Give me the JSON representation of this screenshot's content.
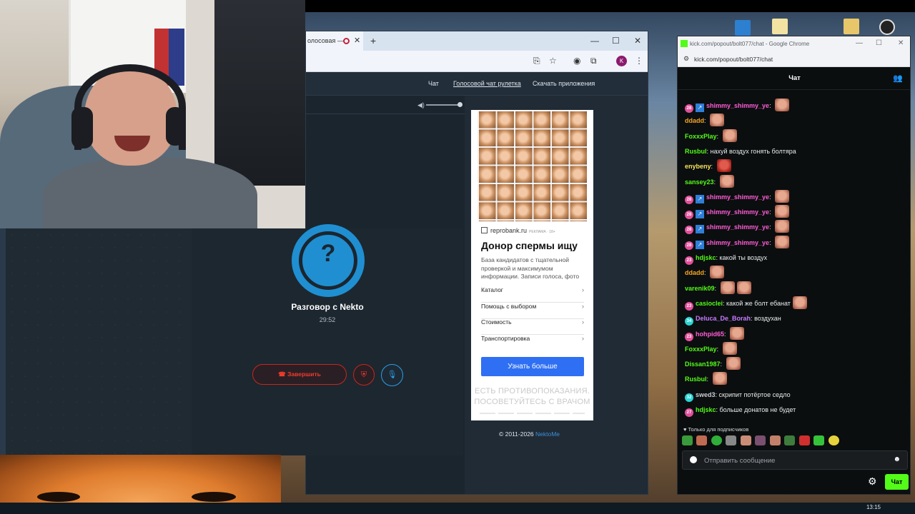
{
  "main_window": {
    "tab_title": "олосовая —",
    "site_nav": {
      "chat": "Чат",
      "voice_roulette": "Голосовой чат рулетка",
      "download": "Скачать приложения"
    },
    "call": {
      "title": "Разговор с Nekto",
      "timer": "29:52",
      "end_label": "Завершить",
      "avatar_glyph": "?"
    },
    "ad": {
      "domain": "reprobank.ru",
      "tag": "РЕКЛАМА · 18+",
      "title": "Донор спермы ищу",
      "description": "База кандидатов с тщательной проверкой и максимумом информации. Записи голоса, фото",
      "items": [
        "Каталог",
        "Помощь с выбором",
        "Стоимость",
        "Транспортировка"
      ],
      "button": "Узнать больше",
      "warning_line1": "ЕСТЬ ПРОТИВОПОКАЗАНИЯ.",
      "warning_line2": "ПОСОВЕТУЙТЕСЬ С ВРАЧОМ"
    },
    "copyright": {
      "text": "© 2011-2026 ",
      "link": "NektoMe"
    },
    "profile_initial": "K"
  },
  "chat_window": {
    "title": "kick.com/popout/bolt077/chat - Google Chrome",
    "url": "kick.com/popout/bolt077/chat",
    "header": "Чат",
    "messages": [
      {
        "badge": "28",
        "badge_color": "#e34f9b",
        "vip": true,
        "user": "shimmy_shimmy_ye",
        "color": "#ff5cd6",
        "text": "",
        "emotes": 1
      },
      {
        "user": "ddadd",
        "color": "#f5a623",
        "text": "",
        "emotes": 1
      },
      {
        "user": "FoxxxPlay",
        "color": "#53fc18",
        "text": "",
        "emotes": 1
      },
      {
        "user": "Rusbul",
        "color": "#53fc18",
        "text": "нахуй воздух гонять болтяра",
        "emotes": 0
      },
      {
        "user": "enybeny",
        "color": "#f5e35a",
        "text": "",
        "emotes": 1,
        "red": true
      },
      {
        "user": "sansey23",
        "color": "#53fc18",
        "text": "",
        "emotes": 1
      },
      {
        "badge": "28",
        "badge_color": "#e34f9b",
        "vip": true,
        "user": "shimmy_shimmy_ye",
        "color": "#ff5cd6",
        "text": "",
        "emotes": 1
      },
      {
        "badge": "28",
        "badge_color": "#e34f9b",
        "vip": true,
        "user": "shimmy_shimmy_ye",
        "color": "#ff5cd6",
        "text": "",
        "emotes": 1
      },
      {
        "badge": "28",
        "badge_color": "#e34f9b",
        "vip": true,
        "user": "shimmy_shimmy_ye",
        "color": "#ff5cd6",
        "text": "",
        "emotes": 1
      },
      {
        "badge": "28",
        "badge_color": "#e34f9b",
        "vip": true,
        "user": "shimmy_shimmy_ye",
        "color": "#ff5cd6",
        "text": "",
        "emotes": 1
      },
      {
        "badge": "23",
        "badge_color": "#e34f9b",
        "user": "hdjskc",
        "color": "#53fc18",
        "text": "какой ты воздух",
        "emotes": 0
      },
      {
        "user": "ddadd",
        "color": "#f5a623",
        "text": "",
        "emotes": 1
      },
      {
        "user": "varenik09",
        "color": "#53fc18",
        "text": "",
        "emotes": 2
      },
      {
        "badge": "23",
        "badge_color": "#e34f9b",
        "user": "casioclei",
        "color": "#53fc18",
        "text": "какой же болт ебанат",
        "emotes": 1
      },
      {
        "badge": "34",
        "badge_color": "#2bd4d4",
        "user": "Deluca_De_Borah",
        "color": "#c67bff",
        "text": "воздухан",
        "emotes": 0
      },
      {
        "badge": "23",
        "badge_color": "#e34f9b",
        "user": "hohpid65",
        "color": "#ff5cd6",
        "text": "",
        "emotes": 1
      },
      {
        "user": "FoxxxPlay",
        "color": "#53fc18",
        "text": "",
        "emotes": 1
      },
      {
        "user": "Dissan1987",
        "color": "#53fc18",
        "text": "",
        "emotes": 1
      },
      {
        "user": "Rusbul",
        "color": "#53fc18",
        "text": "",
        "emotes": 1
      },
      {
        "badge": "32",
        "badge_color": "#2bd4d4",
        "user": "swed3",
        "color": "#c9cdd1",
        "text": "скрипит потёртое седло",
        "emotes": 0
      },
      {
        "badge": "27",
        "badge_color": "#e34f9b",
        "user": "hdjskc",
        "color": "#53fc18",
        "text": "больше донатов не будет",
        "emotes": 0
      }
    ],
    "subs_only": "Только для подписчиков",
    "input_placeholder": "Отправить сообщение",
    "send_label": "Чат"
  },
  "taskbar": {
    "clock": "13:15"
  }
}
